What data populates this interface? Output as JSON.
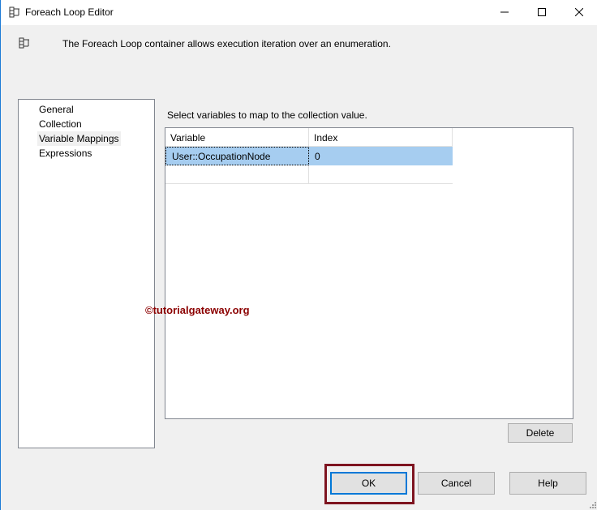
{
  "window": {
    "title": "Foreach Loop Editor",
    "description": "The Foreach Loop container allows execution iteration over an enumeration."
  },
  "nav": {
    "items": [
      "General",
      "Collection",
      "Variable Mappings",
      "Expressions"
    ],
    "selected": 2
  },
  "main": {
    "instruction": "Select variables to map to the collection value.",
    "columns": [
      "Variable",
      "Index"
    ],
    "rows": [
      {
        "variable": "User::OccupationNode",
        "index": "0"
      }
    ]
  },
  "buttons": {
    "delete": "Delete",
    "ok": "OK",
    "cancel": "Cancel",
    "help": "Help"
  },
  "watermark": "©tutorialgateway.org",
  "colors": {
    "selection": "#a6cdf0",
    "highlight_box": "#7e1420",
    "focus": "#0078d7"
  }
}
